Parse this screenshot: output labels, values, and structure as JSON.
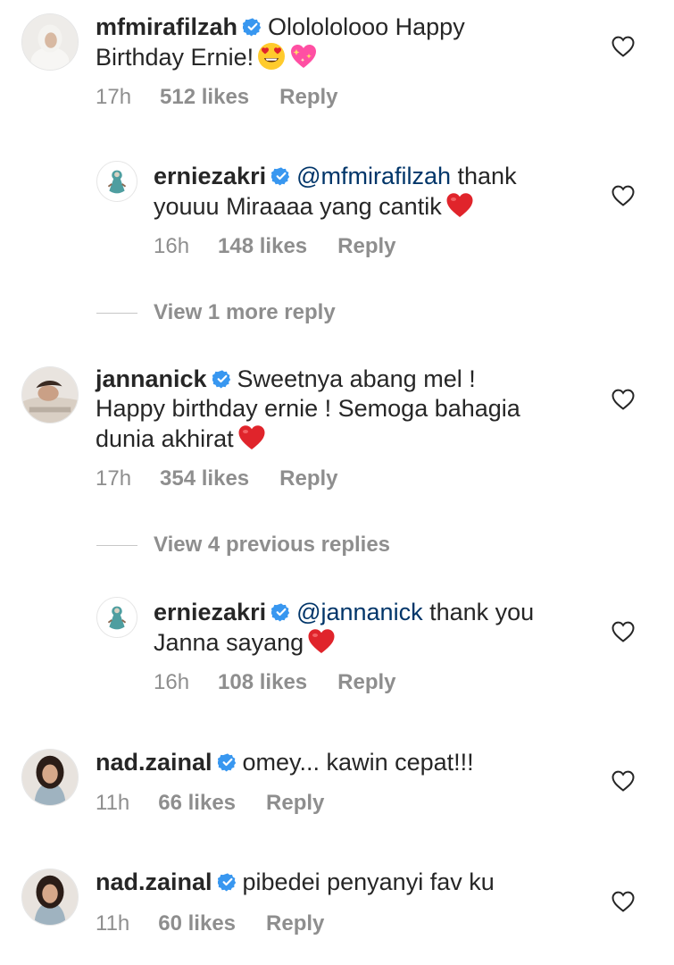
{
  "comments": [
    {
      "username": "mfmirafilzah",
      "mention": "",
      "text_line1": "Ololololooo Happy",
      "text_line2": "Birthday Ernie!",
      "text_line3": "",
      "time": "17h",
      "likes": "512 likes",
      "reply": "Reply",
      "emojis": [
        "heart-eyes-emoji",
        "sparkling-heart-emoji"
      ]
    },
    {
      "username": "erniezakri",
      "mention": "@mfmirafilzah",
      "text_line1": " thank",
      "text_line2": "youuu Miraaaa yang cantik",
      "text_line3": "",
      "time": "16h",
      "likes": "148 likes",
      "reply": "Reply",
      "emojis": [
        "red-heart-emoji"
      ]
    },
    {
      "username": "jannanick",
      "mention": "",
      "text_line1": "Sweetnya abang mel !",
      "text_line2": "Happy birthday ernie ! Semoga bahagia",
      "text_line3": "dunia akhirat",
      "time": "17h",
      "likes": "354 likes",
      "reply": "Reply",
      "emojis": [
        "red-heart-emoji"
      ]
    },
    {
      "username": "erniezakri",
      "mention": "@jannanick",
      "text_line1": " thank you",
      "text_line2": "Janna sayang",
      "text_line3": "",
      "time": "16h",
      "likes": "108 likes",
      "reply": "Reply",
      "emojis": [
        "red-heart-emoji"
      ]
    },
    {
      "username": "nad.zainal",
      "mention": "",
      "text_line1": "omey... kawin cepat!!!",
      "text_line2": "",
      "text_line3": "",
      "time": "11h",
      "likes": "66 likes",
      "reply": "Reply",
      "emojis": []
    },
    {
      "username": "nad.zainal",
      "mention": "",
      "text_line1": "pibedei penyanyi fav ku",
      "text_line2": "",
      "text_line3": "",
      "time": "11h",
      "likes": "60 likes",
      "reply": "Reply",
      "emojis": []
    }
  ],
  "view_more": {
    "first": "View 1 more reply",
    "second": "View 4 previous replies"
  },
  "colors": {
    "text": "#262626",
    "secondary": "#8e8e8e",
    "mention": "#003569",
    "verified": "#3897f0",
    "heart": "#ed4956"
  }
}
